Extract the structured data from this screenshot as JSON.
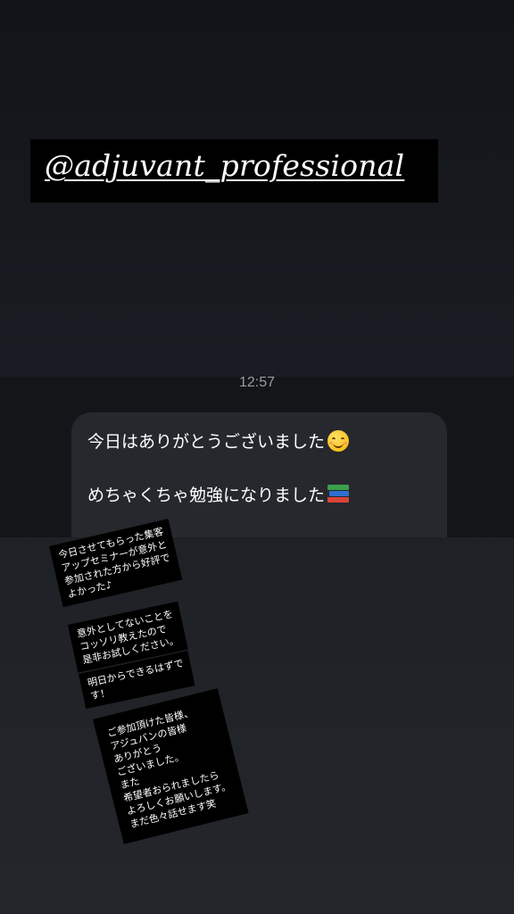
{
  "story": {
    "mention": "@adjuvant_professional"
  },
  "chat": {
    "time": "12:57",
    "message_lines": [
      "今日はありがとうございました",
      "めちゃくちゃ勉強になりました"
    ],
    "emojis": [
      "smiling-face-icon",
      "books-icon"
    ]
  },
  "notes": [
    "今日させてもらった集客\nアップセミナーが意外と\n参加された方から好評で\nよかった♪",
    "意外としてないことを\nコッソリ教えたので\n是非お試しください。",
    "明日からできるはずで\nす！",
    "ご参加頂けた皆様、\nアジュバンの皆様\nありがとう\nございました。\nまた\n希望者おられましたら\nよろしくお願いします。\nまだ色々話せます笑"
  ]
}
